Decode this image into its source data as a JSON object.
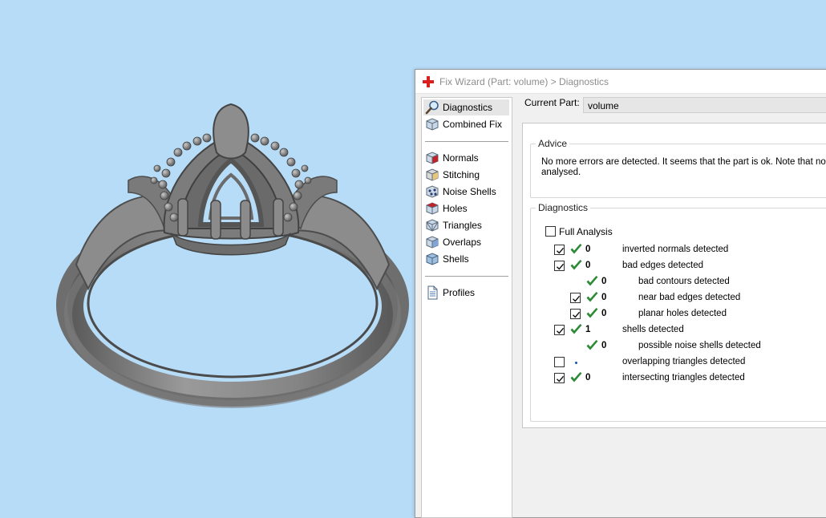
{
  "window": {
    "title": "Fix Wizard (Part: volume) > Diagnostics",
    "colors": {
      "accent_red": "#d9201d",
      "check_green": "#2c8a36"
    }
  },
  "sidebar": {
    "top_items": [
      {
        "label": "Diagnostics",
        "icon": "magnifier-icon",
        "selected": true
      },
      {
        "label": "Combined Fix",
        "icon": "cube-icon"
      }
    ],
    "fix_items": [
      {
        "label": "Normals",
        "icon": "normals-cube-icon"
      },
      {
        "label": "Stitching",
        "icon": "stitching-cube-icon"
      },
      {
        "label": "Noise Shells",
        "icon": "noise-shells-icon"
      },
      {
        "label": "Holes",
        "icon": "holes-cube-icon"
      },
      {
        "label": "Triangles",
        "icon": "triangles-cube-icon"
      },
      {
        "label": "Overlaps",
        "icon": "overlaps-cube-icon"
      },
      {
        "label": "Shells",
        "icon": "shells-cube-icon"
      }
    ],
    "bottom_items": [
      {
        "label": "Profiles",
        "icon": "document-icon"
      }
    ]
  },
  "current_part": {
    "label": "Current Part:",
    "value": "volume"
  },
  "advice": {
    "title": "Advice",
    "text": "No more errors are detected. It seems that the part is ok. Note that no analysed."
  },
  "diagnostics": {
    "title": "Diagnostics",
    "full_analysis": {
      "label": "Full Analysis",
      "checked": false
    },
    "rows": [
      {
        "checked": true,
        "has_checkbox": true,
        "status": "ok",
        "count": "0",
        "label": "inverted normals detected",
        "indent": 0
      },
      {
        "checked": true,
        "has_checkbox": true,
        "status": "ok",
        "count": "0",
        "label": "bad edges detected",
        "indent": 0
      },
      {
        "checked": false,
        "has_checkbox": false,
        "status": "ok",
        "count": "0",
        "label": "bad contours detected",
        "indent": 1
      },
      {
        "checked": true,
        "has_checkbox": true,
        "status": "ok",
        "count": "0",
        "label": "near bad edges detected",
        "indent": 1
      },
      {
        "checked": true,
        "has_checkbox": true,
        "status": "ok",
        "count": "0",
        "label": "planar holes detected",
        "indent": 1
      },
      {
        "checked": true,
        "has_checkbox": true,
        "status": "ok",
        "count": "1",
        "label": "shells detected",
        "indent": 0
      },
      {
        "checked": false,
        "has_checkbox": false,
        "status": "ok",
        "count": "0",
        "label": "possible noise shells detected",
        "indent": 1
      },
      {
        "checked": false,
        "has_checkbox": true,
        "status": "pending",
        "count": "",
        "label": "overlapping triangles detected",
        "indent": 0
      },
      {
        "checked": true,
        "has_checkbox": true,
        "status": "ok",
        "count": "0",
        "label": "intersecting triangles detected",
        "indent": 0
      }
    ]
  },
  "viewport": {
    "background": "#b7dcf7",
    "model_color": "#8a8a8a"
  }
}
